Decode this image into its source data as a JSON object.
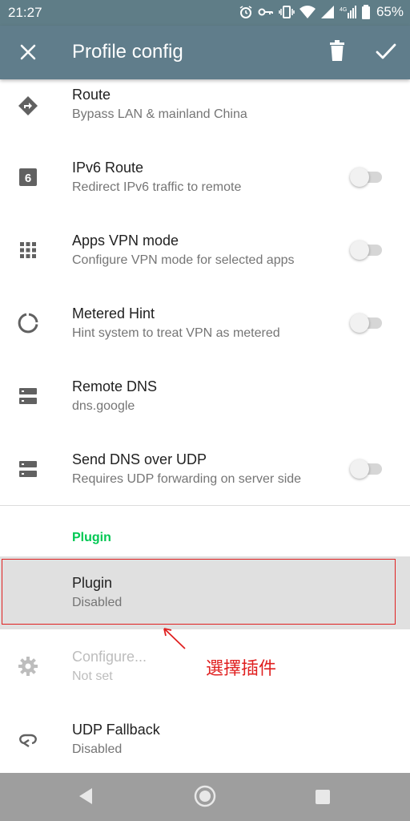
{
  "status_bar": {
    "time": "21:27",
    "battery": "65%"
  },
  "appbar": {
    "title": "Profile config"
  },
  "rows": [
    {
      "title": "Route",
      "summary": "Bypass LAN & mainland China"
    },
    {
      "title": "IPv6 Route",
      "summary": "Redirect IPv6 traffic to remote"
    },
    {
      "title": "Apps VPN mode",
      "summary": "Configure VPN mode for selected apps"
    },
    {
      "title": "Metered Hint",
      "summary": "Hint system to treat VPN as metered"
    },
    {
      "title": "Remote DNS",
      "summary": "dns.google"
    },
    {
      "title": "Send DNS over UDP",
      "summary": "Requires UDP forwarding on server side"
    }
  ],
  "plugin_category": "Plugin",
  "plugin_row": {
    "title": "Plugin",
    "summary": "Disabled"
  },
  "configure_row": {
    "title": "Configure...",
    "summary": "Not set"
  },
  "udp_row": {
    "title": "UDP Fallback",
    "summary": "Disabled"
  },
  "annotation": "選擇插件",
  "colors": {
    "appbar": "#607d8b",
    "category": "#00c853",
    "annotation": "#e02020"
  }
}
